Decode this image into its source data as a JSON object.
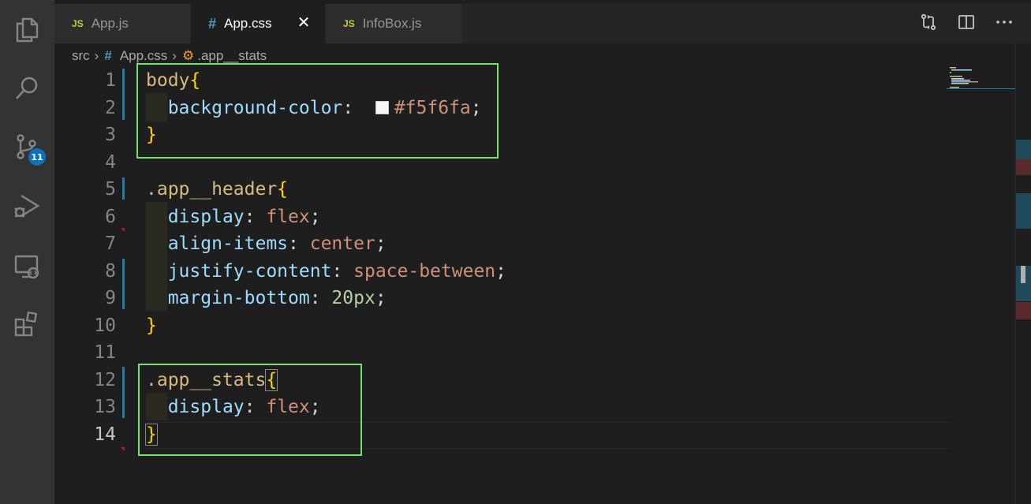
{
  "activity_bar": {
    "icons": [
      "explorer-icon",
      "search-icon",
      "source-control-icon",
      "run-debug-icon",
      "remote-explorer-icon",
      "extensions-icon"
    ],
    "source_control_badge": "11"
  },
  "tabs": [
    {
      "label": "App.js",
      "type_badge": "JS",
      "active": false
    },
    {
      "label": "App.css",
      "type_badge": "#",
      "active": true
    },
    {
      "label": "InfoBox.js",
      "type_badge": "JS",
      "active": false
    }
  ],
  "breadcrumb": {
    "folder": "src",
    "file": "App.css",
    "symbol": ".app__stats"
  },
  "editor": {
    "current_line": 14,
    "lines": [
      {
        "n": "1"
      },
      {
        "n": "2"
      },
      {
        "n": "3"
      },
      {
        "n": "4"
      },
      {
        "n": "5"
      },
      {
        "n": "6"
      },
      {
        "n": "7"
      },
      {
        "n": "8"
      },
      {
        "n": "9"
      },
      {
        "n": "10"
      },
      {
        "n": "11"
      },
      {
        "n": "12"
      },
      {
        "n": "13"
      },
      {
        "n": "14"
      }
    ],
    "code": {
      "l1_sel": "body",
      "l2_prop": "background-color",
      "l2_val": "#f5f6fa",
      "l5_sel": ".app__header",
      "l6_prop": "display",
      "l6_val": "flex",
      "l7_prop": "align-items",
      "l7_val": "center",
      "l8_prop": "justify-content",
      "l8_val": "space-between",
      "l9_prop": "margin-bottom",
      "l9_val": "20px",
      "l12_sel": ".app__stats",
      "l13_prop": "display",
      "l13_val": "flex"
    },
    "swatch_color": "#f5f6fa",
    "highlight_color": "#77e073"
  }
}
